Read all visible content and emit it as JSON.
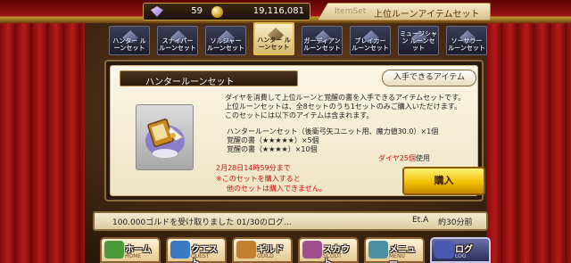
{
  "currency": {
    "gems": "59",
    "gold": "19,116,081"
  },
  "header": {
    "tag": "ItemSet",
    "title": "上位ルーンアイテムセット"
  },
  "tabs": [
    {
      "label": "ハンター ルーンセット"
    },
    {
      "label": "スナイパー ルーンセット"
    },
    {
      "label": "ソルジャー ルーンセット"
    },
    {
      "label": "ハンター ルーンセット"
    },
    {
      "label": "ガーディアン ルーンセット"
    },
    {
      "label": "ブレイカー ルーンセット"
    },
    {
      "label": "ミュージシャン ルーンセット"
    },
    {
      "label": "ソーサラー ルーンセット"
    }
  ],
  "active_tab": 3,
  "set": {
    "name": "ハンタールーンセット",
    "obtain_button": "入手できるアイテム",
    "desc": [
      "ダイヤを消費して上位ルーンと覚醒の書を入手できるアイテムセットです。",
      "上位ルーンセットは、全8セットのうち1セットのみご購入いただけます。",
      "このセットには以下のアイテムは含まれます。"
    ],
    "contents": [
      "ハンタールーンセット（後衛弓矢ユニット用、魔力値30.0）×1個",
      "覚醒の書（★★★★★）×5個",
      "覚醒の書（★★★★）×10個"
    ],
    "price_highlight": "ダイヤ25個",
    "price_suffix": "使用",
    "deadline": "2月28日14時59分まで",
    "warning_1": "※このセットを購入すると",
    "warning_2": "他のセットは購入できません。",
    "buy_button": "購入"
  },
  "log": {
    "text": "100.000ゴルドを受け取りました 01/30のログ...",
    "source": "Et.A",
    "time": "約30分前"
  },
  "nav": [
    {
      "label": "ホーム",
      "sub": "HOME",
      "color": "#4a9a3a"
    },
    {
      "label": "クエスト",
      "sub": "QUEST",
      "color": "#3a7ac0"
    },
    {
      "label": "ギルド",
      "sub": "GUILD",
      "color": "#c08030"
    },
    {
      "label": "スカウト",
      "sub": "SCOUT",
      "color": "#a05090"
    },
    {
      "label": "メニュー",
      "sub": "MENU",
      "color": "#4a90a0"
    },
    {
      "label": "ログ",
      "sub": "LOG",
      "color": "#4a5ab0"
    }
  ],
  "active_nav": 5
}
